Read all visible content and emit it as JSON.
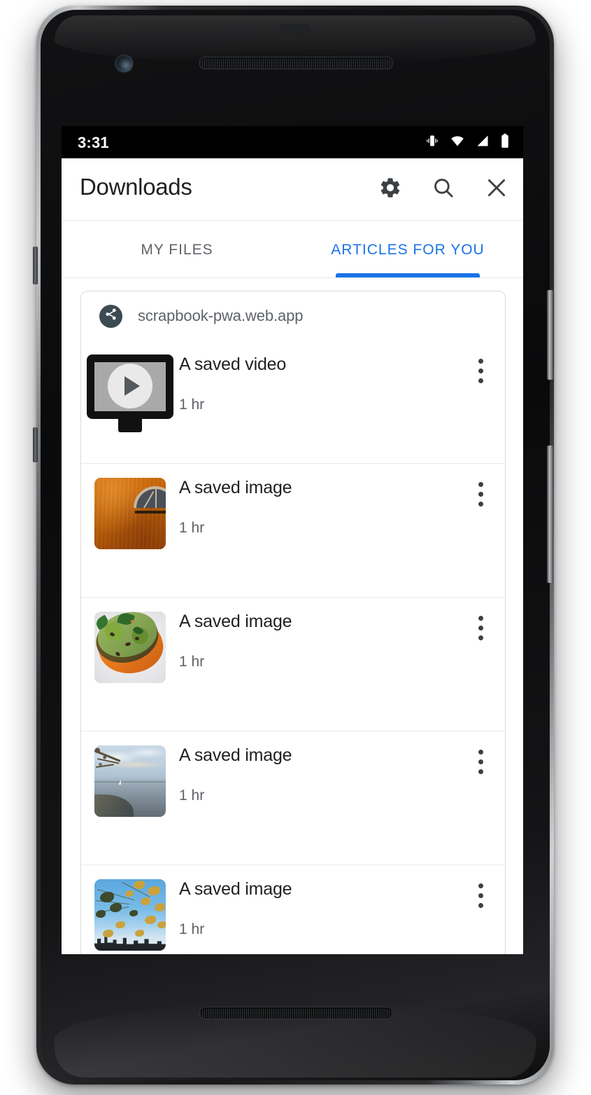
{
  "status_bar": {
    "time": "3:31",
    "icons": [
      "vibrate-icon",
      "wifi-icon",
      "cell-signal-icon",
      "battery-icon"
    ]
  },
  "toolbar": {
    "title": "Downloads",
    "actions": [
      {
        "name": "settings-button",
        "icon": "gear-icon"
      },
      {
        "name": "search-button",
        "icon": "search-icon"
      },
      {
        "name": "close-button",
        "icon": "close-icon"
      }
    ]
  },
  "tabs": [
    {
      "label": "MY FILES",
      "active": false
    },
    {
      "label": "ARTICLES FOR YOU",
      "active": true
    }
  ],
  "card": {
    "site_icon": "share-icon",
    "site_url": "scrapbook-pwa.web.app",
    "items": [
      {
        "title": "A saved video",
        "subtitle": "1 hr",
        "thumb": "video-placeholder-icon",
        "menu": "overflow-menu-icon"
      },
      {
        "title": "A saved image",
        "subtitle": "1 hr",
        "thumb": "orange-wall-photo",
        "menu": "overflow-menu-icon"
      },
      {
        "title": "A saved image",
        "subtitle": "1 hr",
        "thumb": "avocado-toast-photo",
        "menu": "overflow-menu-icon"
      },
      {
        "title": "A saved image",
        "subtitle": "1 hr",
        "thumb": "seaside-photo",
        "menu": "overflow-menu-icon"
      },
      {
        "title": "A saved image",
        "subtitle": "1 hr",
        "thumb": "autumn-city-photo",
        "menu": "overflow-menu-icon"
      }
    ]
  },
  "colors": {
    "accent_blue": "#1a73e8",
    "text_primary": "#202124",
    "text_secondary": "#5f6368",
    "divider": "#e8eaed",
    "card_border": "#dadce0",
    "site_badge": "#3c4a52",
    "status_bar_bg": "#000000",
    "surface": "#ffffff"
  }
}
